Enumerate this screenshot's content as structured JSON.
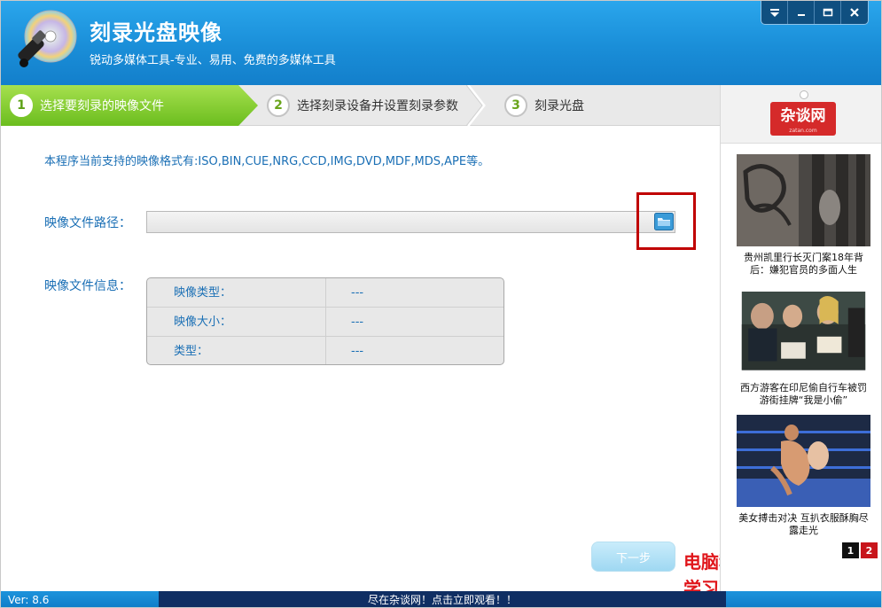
{
  "app": {
    "title": "刻录光盘映像",
    "subtitle": "锐动多媒体工具-专业、易用、免费的多媒体工具",
    "controls": [
      "menu",
      "minimize",
      "maximize",
      "close"
    ]
  },
  "steps": [
    {
      "num": "1",
      "label": "选择要刻录的映像文件",
      "active": true
    },
    {
      "num": "2",
      "label": "选择刻录设备并设置刻录参数",
      "active": false
    },
    {
      "num": "3",
      "label": "刻录光盘",
      "active": false
    }
  ],
  "content": {
    "formats_text": "本程序当前支持的映像格式有:ISO,BIN,CUE,NRG,CCD,IMG,DVD,MDF,MDS,APE等。",
    "path_label": "映像文件路径：",
    "path_value": "",
    "info_label": "映像文件信息：",
    "info_rows": [
      {
        "key": "映像类型：",
        "value": "---"
      },
      {
        "key": "映像大小：",
        "value": "---"
      },
      {
        "key": "类型：",
        "value": "---"
      }
    ],
    "next_button": "下一步"
  },
  "sidebar": {
    "logo_text": "杂谈网",
    "logo_sub": "zatan.com",
    "ads": [
      {
        "caption": "贵州凯里行长灭门案18年背后：嫌犯官员的多面人生"
      },
      {
        "caption": "西方游客在印尼偷自行车被罚游街挂牌“我是小偷”"
      },
      {
        "caption": "美女搏击对决 互扒衣服酥胸尽露走光"
      }
    ],
    "pages": [
      "1",
      "2"
    ]
  },
  "watermark": {
    "line1": "电脑科技",
    "line2": "学习更多电脑知识"
  },
  "statusbar": {
    "version": "Ver: 8.6",
    "banner": "尽在杂谈网！点击立即观看！！"
  },
  "colors": {
    "header_blue": "#1a8ed8",
    "step_green": "#6bbd1e",
    "text_blue": "#1a6fb5",
    "highlight_red": "#c00000",
    "banner_navy": "#0f2e63"
  }
}
